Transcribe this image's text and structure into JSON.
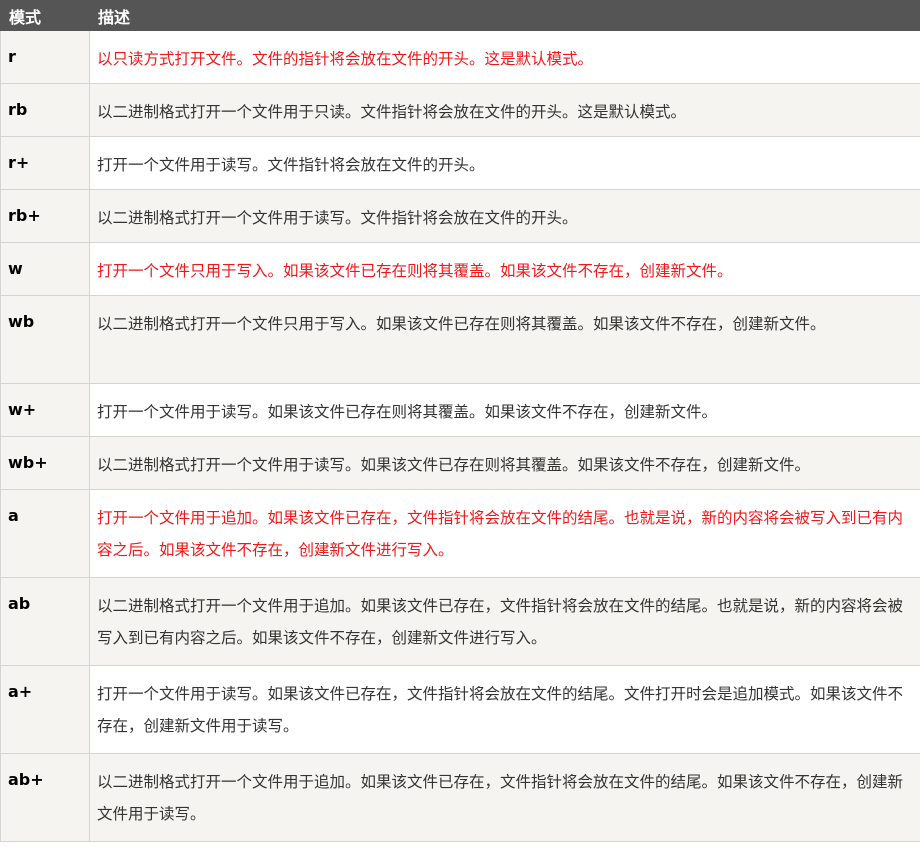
{
  "table": {
    "headers": [
      "模式",
      "描述"
    ],
    "rows": [
      {
        "mode": "r",
        "desc": "以只读方式打开文件。文件的指针将会放在文件的开头。这是默认模式。",
        "highlight": true
      },
      {
        "mode": "rb",
        "desc": "以二进制格式打开一个文件用于只读。文件指针将会放在文件的开头。这是默认模式。",
        "highlight": false
      },
      {
        "mode": "r+",
        "desc": "打开一个文件用于读写。文件指针将会放在文件的开头。",
        "highlight": false
      },
      {
        "mode": "rb+",
        "desc": "以二进制格式打开一个文件用于读写。文件指针将会放在文件的开头。",
        "highlight": false
      },
      {
        "mode": "w",
        "desc": "打开一个文件只用于写入。如果该文件已存在则将其覆盖。如果该文件不存在，创建新文件。",
        "highlight": true
      },
      {
        "mode": "wb",
        "desc": "以二进制格式打开一个文件只用于写入。如果该文件已存在则将其覆盖。如果该文件不存在，创建新文件。",
        "highlight": false
      },
      {
        "mode": "w+",
        "desc": "打开一个文件用于读写。如果该文件已存在则将其覆盖。如果该文件不存在，创建新文件。",
        "highlight": false
      },
      {
        "mode": "wb+",
        "desc": "以二进制格式打开一个文件用于读写。如果该文件已存在则将其覆盖。如果该文件不存在，创建新文件。",
        "highlight": false
      },
      {
        "mode": "a",
        "desc": "打开一个文件用于追加。如果该文件已存在，文件指针将会放在文件的结尾。也就是说，新的内容将会被写入到已有内容之后。如果该文件不存在，创建新文件进行写入。",
        "highlight": true
      },
      {
        "mode": "ab",
        "desc": "以二进制格式打开一个文件用于追加。如果该文件已存在，文件指针将会放在文件的结尾。也就是说，新的内容将会被写入到已有内容之后。如果该文件不存在，创建新文件进行写入。",
        "highlight": false
      },
      {
        "mode": "a+",
        "desc": "打开一个文件用于读写。如果该文件已存在，文件指针将会放在文件的结尾。文件打开时会是追加模式。如果该文件不存在，创建新文件用于读写。",
        "highlight": false
      },
      {
        "mode": "ab+",
        "desc": "以二进制格式打开一个文件用于追加。如果该文件已存在，文件指针将会放在文件的结尾。如果该文件不存在，创建新文件用于读写。",
        "highlight": false
      }
    ]
  },
  "colors": {
    "header_bg": "#555555",
    "header_text": "#ffffff",
    "highlight_text": "#f01818",
    "body_text": "#333333",
    "alt_row_bg": "#f6f4f0"
  }
}
